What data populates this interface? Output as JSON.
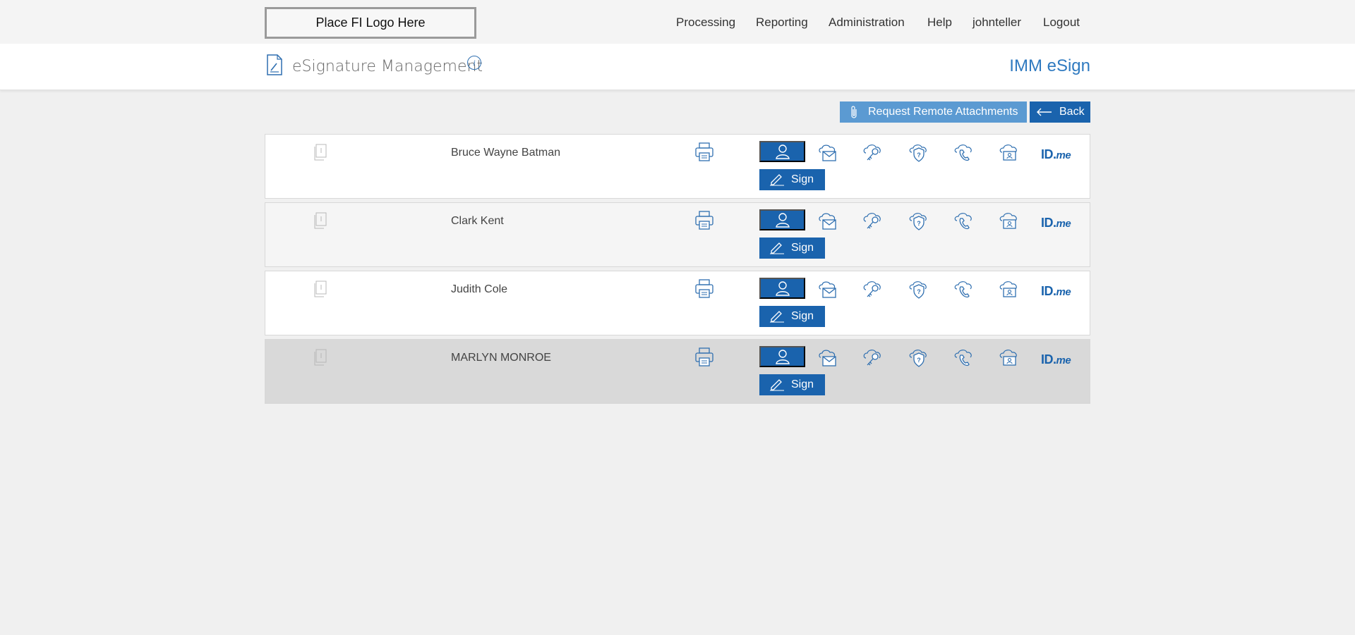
{
  "topbar": {
    "logo_text": "Place FI Logo Here",
    "nav": [
      "Processing",
      "Reporting",
      "Administration",
      "Help",
      "johnteller",
      "Logout"
    ]
  },
  "header": {
    "title": "eSignature Management",
    "info_glyph": "i",
    "brand": "IMM eSign"
  },
  "actions": {
    "request_attachments": "Request Remote Attachments",
    "back": "Back"
  },
  "signers": [
    {
      "name": "Bruce Wayne Batman"
    },
    {
      "name": "Clark Kent"
    },
    {
      "name": "Judith Cole"
    },
    {
      "name": "MARLYN MONROE"
    }
  ],
  "row_labels": {
    "sign": "Sign",
    "idme_main": "ID.",
    "idme_suffix": "me"
  },
  "icons": [
    "document-edit-icon",
    "info-icon",
    "paperclip-icon",
    "back-arrow-icon",
    "pages-icon",
    "printer-icon",
    "person-icon",
    "email-cloud-icon",
    "key-cloud-icon",
    "question-cloud-icon",
    "phone-cloud-icon",
    "idcard-cloud-icon",
    "pen-icon"
  ],
  "colors": {
    "primary": "#1a63ad",
    "secondary": "#5b9ad2",
    "brand_text": "#2f7ac0",
    "background": "#f0f0f0"
  }
}
